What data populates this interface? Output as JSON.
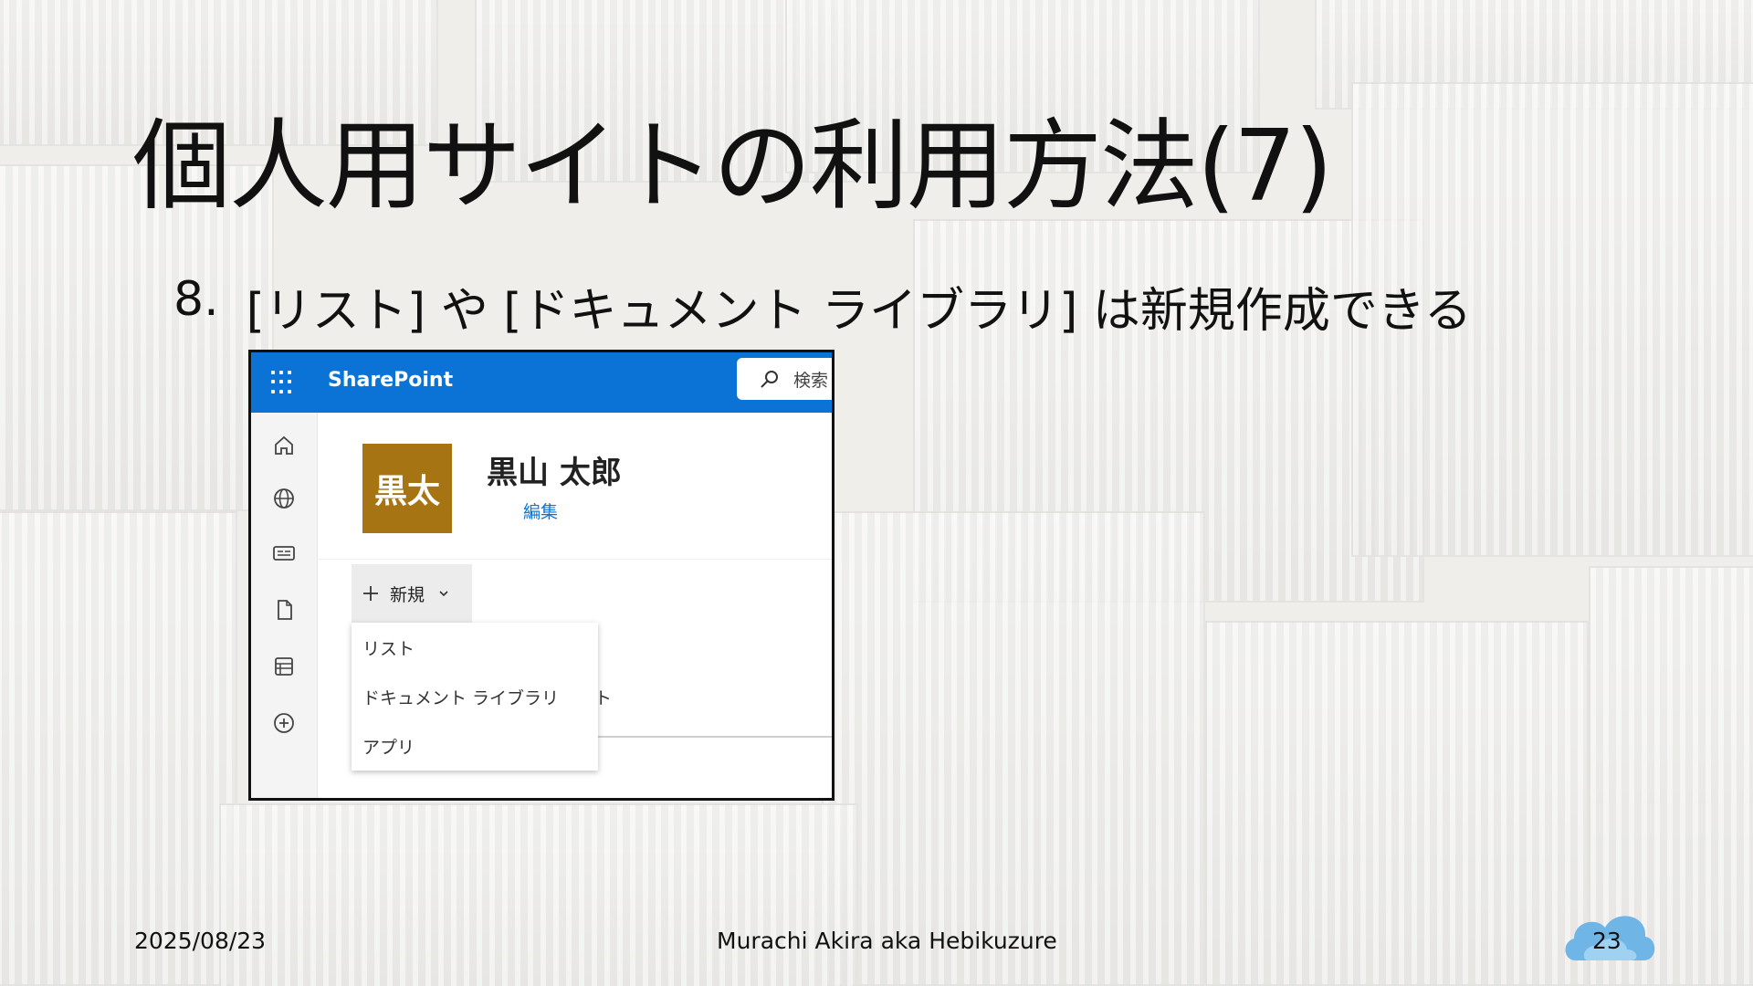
{
  "slide": {
    "title": "個人用サイトの利用方法(7)",
    "bullet_number": "8.",
    "bullet_text": "[リスト] や [ドキュメント ライブラリ] は新規作成できる"
  },
  "footer": {
    "date": "2025/08/23",
    "author": "Murachi Akira aka Hebikuzure",
    "page_number": "23"
  },
  "sharepoint": {
    "brand": "SharePoint",
    "search_placeholder": "検索",
    "site": {
      "avatar_text": "黒太",
      "name": "黒山 太郎",
      "edit_label": "編集"
    },
    "new_button_label": "新規",
    "new_menu": [
      {
        "label": "リスト"
      },
      {
        "label": "ドキュメント ライブラリ"
      },
      {
        "label": "アプリ"
      }
    ],
    "partially_hidden_text": "ト",
    "rail_icons": [
      "home-icon",
      "globe-icon",
      "news-icon",
      "file-icon",
      "list-icon",
      "add-circle-icon"
    ],
    "colors": {
      "topbar": "#0b73d6",
      "avatar": "#a67413",
      "link": "#0b73d6"
    }
  }
}
